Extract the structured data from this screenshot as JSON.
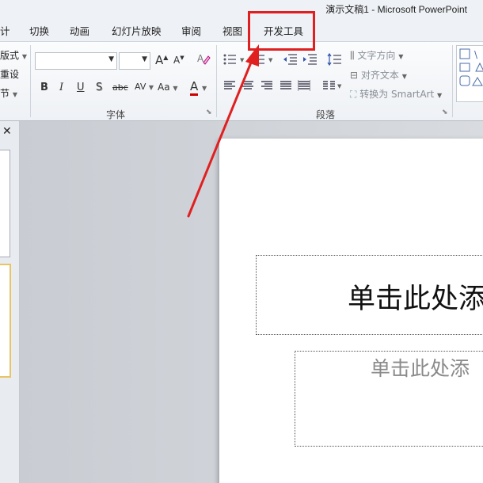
{
  "window": {
    "title": "演示文稿1 - Microsoft PowerPoint"
  },
  "tabs": {
    "partial_left": "计",
    "transitions": "切换",
    "animations": "动画",
    "slideshow": "幻灯片放映",
    "review": "审阅",
    "view": "视图",
    "developer": "开发工具"
  },
  "ribbon": {
    "slides_group": {
      "layout": "版式",
      "reset": "重设",
      "section": "节"
    },
    "font_group": {
      "label": "字体",
      "bold": "B",
      "italic": "I",
      "underline": "U",
      "shadow": "S",
      "strikethrough": "abc",
      "spacing": "AV",
      "change_case": "Aa",
      "grow": "A",
      "shrink": "A",
      "font_color": "A"
    },
    "paragraph_group": {
      "label": "段落",
      "text_direction": "文字方向",
      "align_text": "对齐文本",
      "convert_smartart": "转换为 SmartArt"
    }
  },
  "slide": {
    "title_placeholder": "单击此处添",
    "subtitle_placeholder": "单击此处添"
  },
  "annotation": {
    "color": "#e02020"
  }
}
